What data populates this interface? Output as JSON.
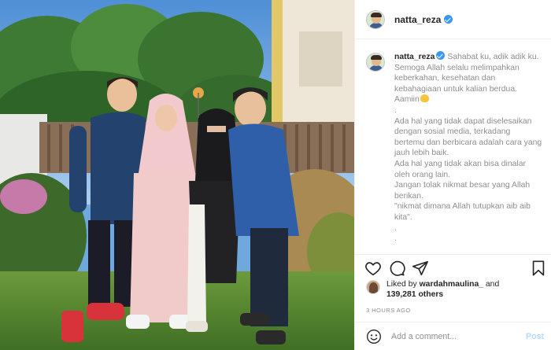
{
  "post": {
    "username": "natta_reza",
    "caption_lines": [
      "Sahabat ku, adik adik ku.",
      "Semoga Allah selalu melimpahkan keberkahan, kesehatan dan kebahagiaan untuk kalian berdua. Aamiin",
      ".",
      "Ada hal yang tidak dapat diselesaikan dengan sosial media, terkadang bertemu dan berbicara adalah cara yang jauh lebih baik.",
      "Ada hal yang tidak akan bisa dinalar oleh orang lain.",
      "Jangan tolak nikmat besar yang Allah berikan.",
      "\"nikmat dimana Allah tutupkan aib aib kita\".",
      ".",
      "."
    ],
    "likes": {
      "prefix": "Liked by",
      "first_user": "wardahmaulina_",
      "joiner": "and",
      "count": "139,281 others"
    },
    "time_ago": "3 HOURS AGO"
  },
  "actions": {
    "like_icon": "heart-icon",
    "comment_icon": "comment-icon",
    "share_icon": "share-icon",
    "save_icon": "bookmark-icon"
  },
  "comment_box": {
    "placeholder": "Add a comment...",
    "post_label": "Post"
  },
  "colors": {
    "verified": "#3897f0",
    "post_button_disabled": "#b3dbff",
    "secondary_text": "#8e8e8e"
  }
}
